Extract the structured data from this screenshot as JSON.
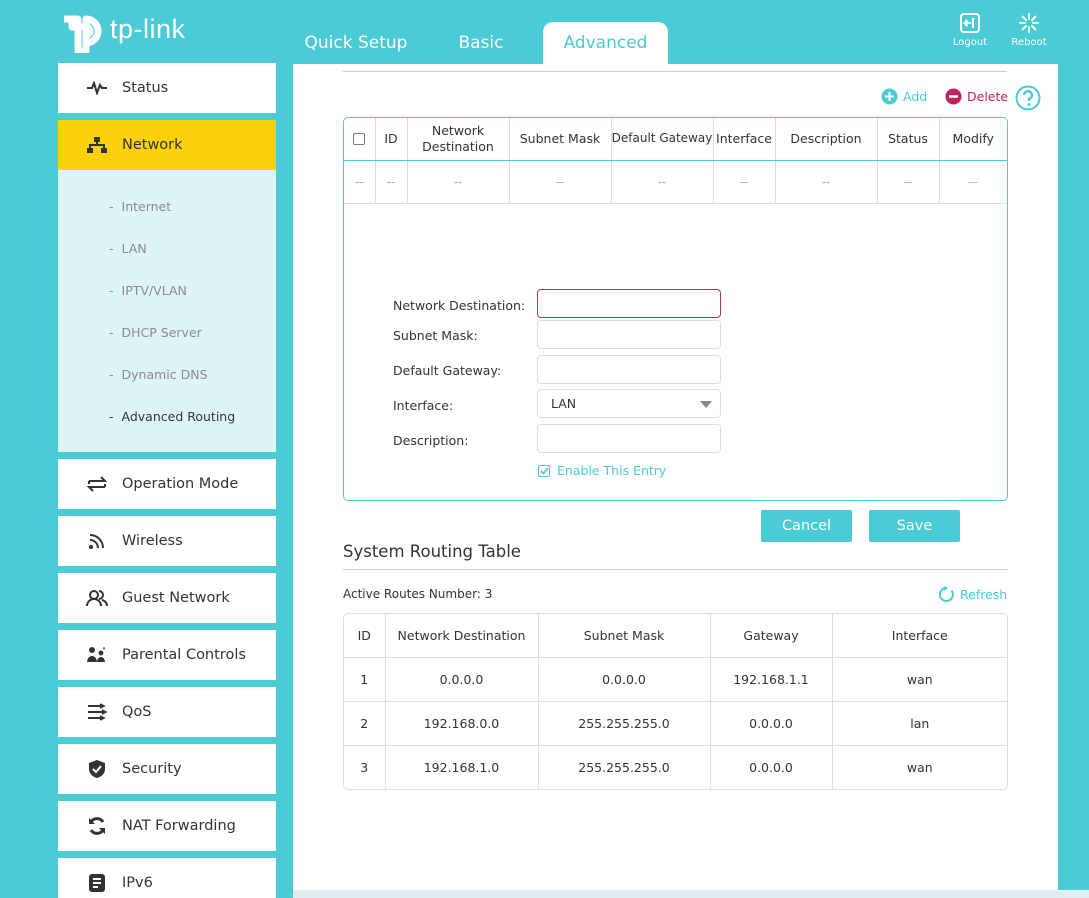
{
  "brand": {
    "logo_text": "tp-link"
  },
  "tabs": [
    {
      "label": "Quick Setup"
    },
    {
      "label": "Basic"
    },
    {
      "label": "Advanced"
    }
  ],
  "header_buttons": {
    "logout": "Logout",
    "reboot": "Reboot"
  },
  "sidebar": {
    "items": [
      {
        "label": "Status",
        "icon": "pulse-icon"
      },
      {
        "label": "Network",
        "icon": "network-icon"
      },
      {
        "label": "Operation Mode",
        "icon": "swap-icon"
      },
      {
        "label": "Wireless",
        "icon": "wifi-icon"
      },
      {
        "label": "Guest Network",
        "icon": "guest-users-icon"
      },
      {
        "label": "Parental Controls",
        "icon": "parental-icon"
      },
      {
        "label": "QoS",
        "icon": "qos-icon"
      },
      {
        "label": "Security",
        "icon": "shield-icon"
      },
      {
        "label": "NAT Forwarding",
        "icon": "nat-icon"
      },
      {
        "label": "IPv6",
        "icon": "ipv6-icon"
      }
    ],
    "network_sub": [
      "Internet",
      "LAN",
      "IPTV/VLAN",
      "DHCP Server",
      "Dynamic DNS",
      "Advanced Routing"
    ],
    "sub_dash": "-"
  },
  "static_routing": {
    "add_label": "Add",
    "delete_label": "Delete",
    "columns": [
      "ID",
      "Network Destination",
      "Subnet Mask",
      "Default Gateway",
      "Interface",
      "Description",
      "Status",
      "Modify"
    ],
    "empty_cell": "--",
    "form": {
      "network_destination_label": "Network Destination:",
      "subnet_mask_label": "Subnet Mask:",
      "default_gateway_label": "Default Gateway:",
      "interface_label": "Interface:",
      "description_label": "Description:",
      "network_destination_value": "",
      "subnet_mask_value": "",
      "default_gateway_value": "",
      "interface_value": "LAN",
      "description_value": "",
      "enable_label": "Enable This Entry",
      "enable_checked": true,
      "cancel_label": "Cancel",
      "save_label": "Save"
    }
  },
  "system_routing": {
    "title": "System Routing Table",
    "active_routes_label": "Active Routes Number:",
    "active_routes_count": "3",
    "refresh_label": "Refresh",
    "columns": [
      "ID",
      "Network Destination",
      "Subnet Mask",
      "Gateway",
      "Interface"
    ],
    "rows": [
      [
        "1",
        "0.0.0.0",
        "0.0.0.0",
        "192.168.1.1",
        "wan"
      ],
      [
        "2",
        "192.168.0.0",
        "255.255.255.0",
        "0.0.0.0",
        "lan"
      ],
      [
        "3",
        "192.168.1.0",
        "255.255.255.0",
        "0.0.0.0",
        "wan"
      ]
    ]
  },
  "colors": {
    "accent": "#4acbd6",
    "active_menu": "#fdd20c",
    "delete": "#c0225e",
    "focus_border": "#a63a6a"
  }
}
